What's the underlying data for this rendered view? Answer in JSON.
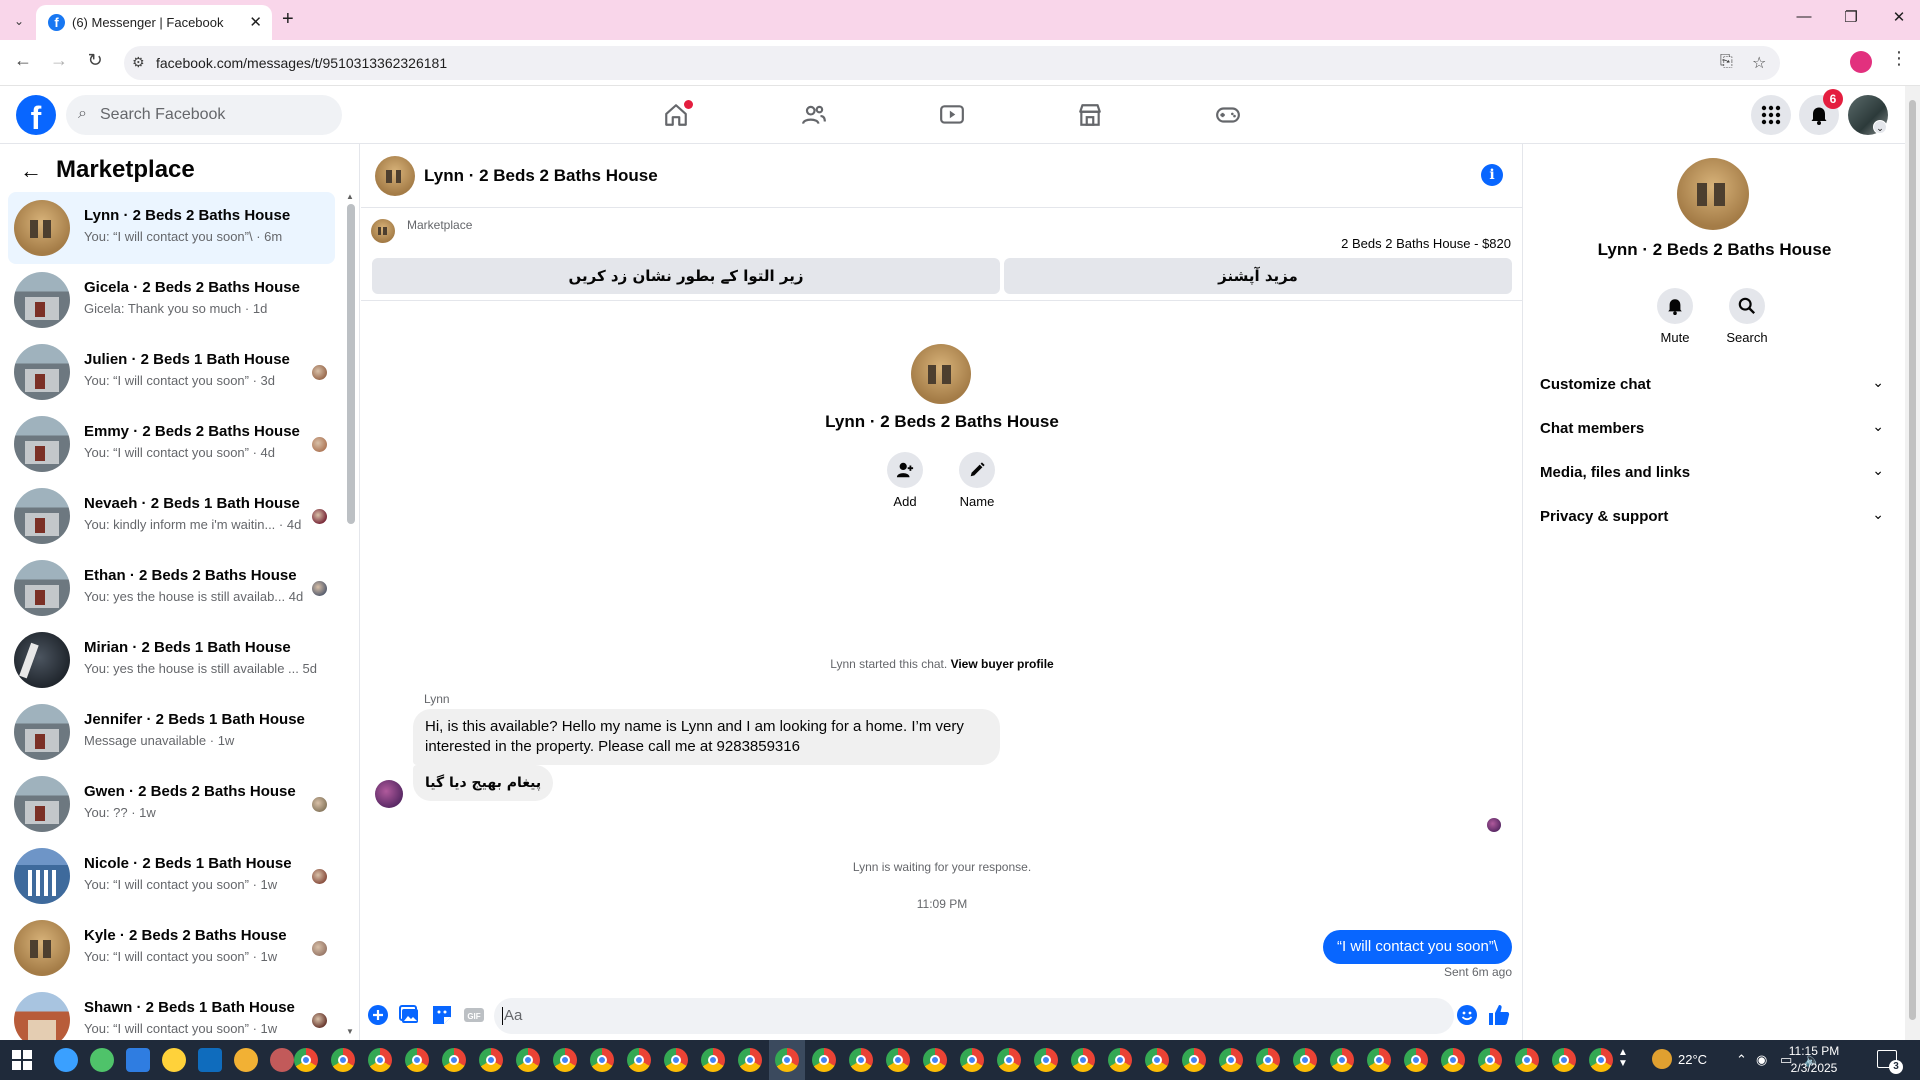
{
  "browser": {
    "tab_title": "(6) Messenger | Facebook",
    "url": "facebook.com/messages/t/9510313362326181"
  },
  "facebook": {
    "search_placeholder": "Search Facebook",
    "notification_count": "6"
  },
  "sidebar": {
    "title": "Marketplace",
    "conversations": [
      {
        "name": "Lynn · 2 Beds 2 Baths House",
        "preview": "You: “I will contact you soon”\\ · 6m",
        "thumb": "gold",
        "active": true
      },
      {
        "name": "Gicela · 2 Beds 2 Baths House",
        "preview": "Gicela: Thank you so much · 1d",
        "thumb": "gray"
      },
      {
        "name": "Julien · 2 Beds 1 Bath House",
        "preview": "You: “I will contact you soon” · 3d",
        "thumb": "gray",
        "mini": "#9a6b4f"
      },
      {
        "name": "Emmy · 2 Beds 2 Baths House",
        "preview": "You: “I will contact you soon” · 4d",
        "thumb": "gray",
        "mini": "#b07a5a"
      },
      {
        "name": "Nevaeh · 2 Beds 1 Bath House",
        "preview": "You: kindly inform me i'm waitin... · 4d",
        "thumb": "gray",
        "mini": "#7a2a3a"
      },
      {
        "name": "Ethan · 2 Beds 2 Baths House",
        "preview": "You: yes the house is still availab... 4d",
        "thumb": "gray",
        "mini": "#5a6070"
      },
      {
        "name": "Mirian · 2 Beds 1 Bath House",
        "preview": "You: yes the house is still available ... 5d",
        "thumb": "dark"
      },
      {
        "name": "Jennifer · 2 Beds 1 Bath House",
        "preview": "Message unavailable · 1w",
        "thumb": "gray"
      },
      {
        "name": "Gwen · 2 Beds 2 Baths House",
        "preview": "You: ?? · 1w",
        "thumb": "gray",
        "mini": "#8a7a60"
      },
      {
        "name": "Nicole · 2 Beds 1 Bath House",
        "preview": "You: “I will contact you soon” · 1w",
        "thumb": "blue",
        "mini": "#8a5040"
      },
      {
        "name": "Kyle · 2 Beds 2 Baths House",
        "preview": "You: “I will contact you soon” · 1w",
        "thumb": "gold",
        "mini": "#9a7a6a"
      },
      {
        "name": "Shawn · 2 Beds 1 Bath House",
        "preview": "You: “I will contact you soon” · 1w",
        "thumb": "brick",
        "mini": "#6a3a30"
      }
    ]
  },
  "chat": {
    "header_name": "Lynn · 2 Beds 2 Baths House",
    "marketplace_label": "Marketplace",
    "listing_price": "2 Beds 2 Baths House - $820",
    "btn_mark_pending": "زیر التوا کے بطور نشان زد کریں",
    "btn_more_options": "مزید آپشنز",
    "intro_name": "Lynn · 2 Beds 2 Baths House",
    "add_label": "Add",
    "name_label": "Name",
    "started_text": "Lynn started this chat.",
    "buyer_profile_link": "View buyer profile",
    "sender_name": "Lynn",
    "message_1": "Hi, is this available? Hello my name is Lynn and I am looking for a home. I’m very interested in the property.   Please call me at 9283859316",
    "message_2": "پیغام بھیج دیا گیا",
    "waiting_text": "Lynn is waiting for your response.",
    "timestamp": "11:09 PM",
    "outgoing_message": "“I will contact you soon”\\",
    "sent_status": "Sent 6m ago",
    "composer_placeholder": "Aa"
  },
  "details": {
    "name": "Lynn · 2 Beds 2 Baths House",
    "mute_label": "Mute",
    "search_label": "Search",
    "sections": [
      "Customize chat",
      "Chat members",
      "Media, files and links",
      "Privacy & support"
    ]
  },
  "taskbar": {
    "temperature": "22°C",
    "time": "11:15 PM",
    "date": "2/3/2025",
    "notifications": "3"
  },
  "colors": {
    "accent": "#0866ff",
    "tabbar": "#f9d6ea",
    "badge": "#e41e3f"
  }
}
